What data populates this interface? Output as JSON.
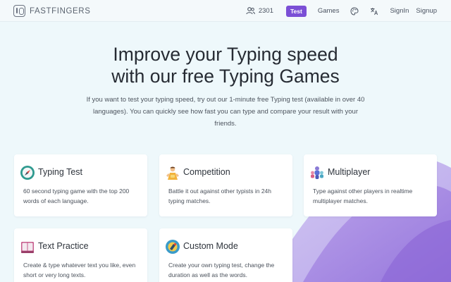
{
  "header": {
    "logo_text": "FASTFINGERS",
    "users_count": "2301",
    "nav": {
      "test": "Test",
      "games": "Games",
      "signin": "SignIn",
      "signup": "Signup"
    }
  },
  "hero": {
    "title_line1": "Improve your Typing speed",
    "title_line2": "with our free Typing Games",
    "description": "If you want to test your typing speed, try out our 1-minute free Typing test (available in over 40 languages). You can quickly see how fast you can type and compare your result with your friends."
  },
  "cards": [
    {
      "title": "Typing Test",
      "description": "60 second typing game with the top 200 words of each language.",
      "icon": "compass-icon"
    },
    {
      "title": "Competition",
      "description": "Battle it out against other typists in 24h typing matches.",
      "icon": "trophy-person-icon"
    },
    {
      "title": "Multiplayer",
      "description": "Type against other players in realtime multiplayer matches.",
      "icon": "group-players-icon"
    },
    {
      "title": "Text Practice",
      "description": "Create & type whatever text you like, even short or very long texts.",
      "icon": "book-icon"
    },
    {
      "title": "Custom Mode",
      "description": "Create your own typing test, change the duration as well as the words.",
      "icon": "custom-gear-icon"
    }
  ],
  "colors": {
    "accent": "#7b4fd6",
    "background": "#eef8fb",
    "wave_purple": "#9b7fe0"
  }
}
